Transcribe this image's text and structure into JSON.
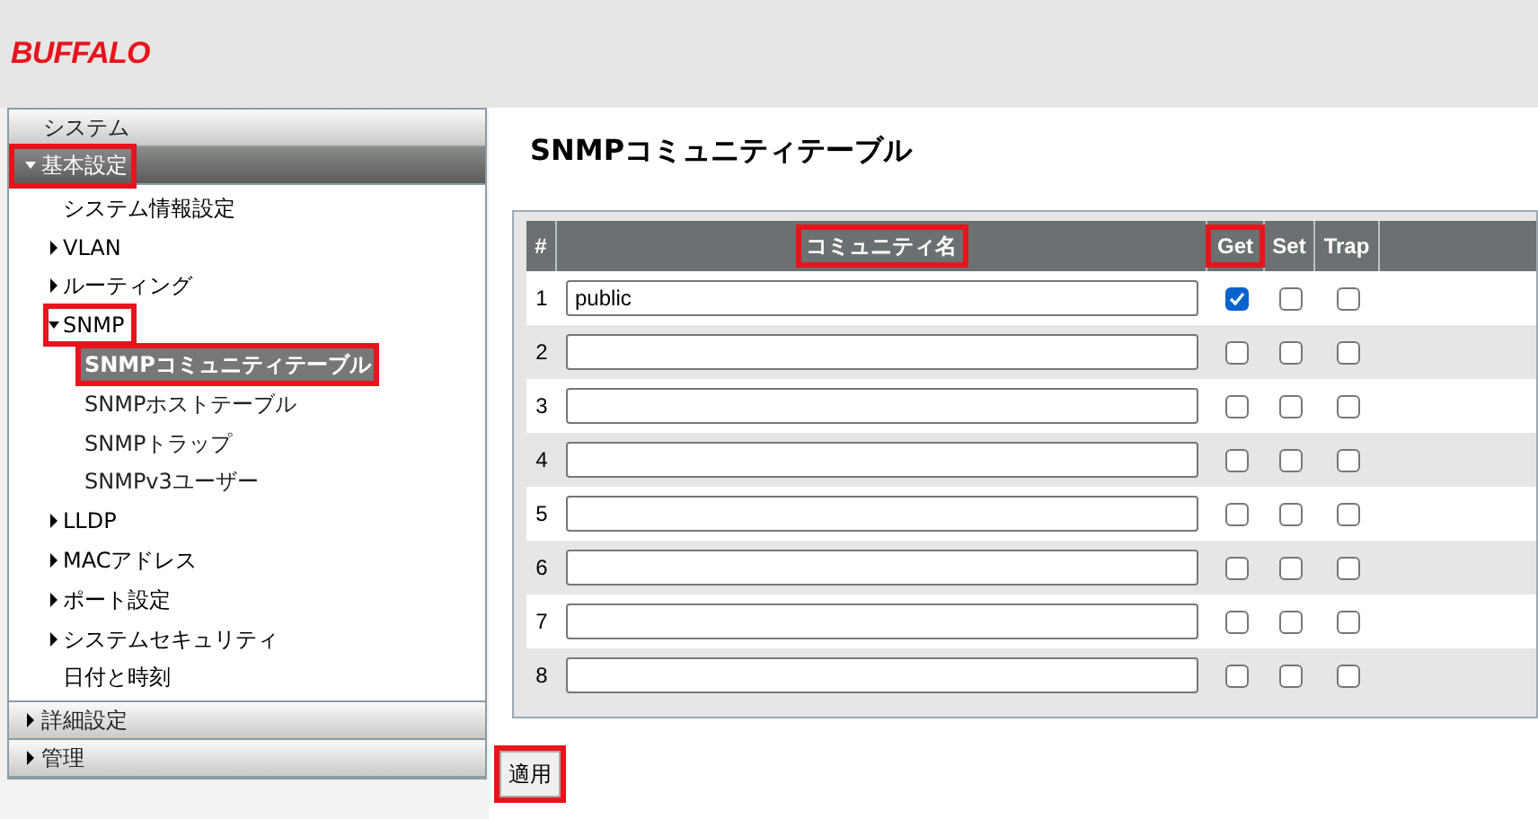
{
  "logo": "BUFFALO",
  "sidebar": {
    "sections": [
      {
        "label": "システム",
        "kind": "plain",
        "expanded": false,
        "highlighted": false
      },
      {
        "label": "基本設定",
        "kind": "toggle",
        "expanded": true,
        "highlighted": true,
        "items": [
          {
            "label": "システム情報設定",
            "kind": "leaf",
            "selected": false,
            "highlighted": false
          },
          {
            "label": "VLAN",
            "kind": "group",
            "expanded": false,
            "selected": false,
            "highlighted": false
          },
          {
            "label": "ルーティング",
            "kind": "group",
            "expanded": false,
            "selected": false,
            "highlighted": false
          },
          {
            "label": "SNMP",
            "kind": "group",
            "expanded": true,
            "selected": false,
            "highlighted": true,
            "children": [
              {
                "label": "SNMPコミュニティテーブル",
                "selected": true,
                "highlighted": true
              },
              {
                "label": "SNMPホストテーブル",
                "selected": false,
                "highlighted": false
              },
              {
                "label": "SNMPトラップ",
                "selected": false,
                "highlighted": false
              },
              {
                "label": "SNMPv3ユーザー",
                "selected": false,
                "highlighted": false
              }
            ]
          },
          {
            "label": "LLDP",
            "kind": "group",
            "expanded": false,
            "selected": false,
            "highlighted": false
          },
          {
            "label": "MACアドレス",
            "kind": "group",
            "expanded": false,
            "selected": false,
            "highlighted": false
          },
          {
            "label": "ポート設定",
            "kind": "group",
            "expanded": false,
            "selected": false,
            "highlighted": false
          },
          {
            "label": "システムセキュリティ",
            "kind": "group",
            "expanded": false,
            "selected": false,
            "highlighted": false
          },
          {
            "label": "日付と時刻",
            "kind": "leaf",
            "selected": false,
            "highlighted": false
          }
        ]
      },
      {
        "label": "詳細設定",
        "kind": "toggle",
        "expanded": false,
        "highlighted": false
      },
      {
        "label": "管理",
        "kind": "toggle",
        "expanded": false,
        "highlighted": false
      }
    ]
  },
  "page_title": "SNMPコミュニティテーブル",
  "table": {
    "columns": [
      {
        "label": "#",
        "highlighted": false
      },
      {
        "label": "コミュニティ名",
        "highlighted": true
      },
      {
        "label": "Get",
        "highlighted": true
      },
      {
        "label": "Set",
        "highlighted": false
      },
      {
        "label": "Trap",
        "highlighted": false
      }
    ],
    "rows": [
      {
        "index": "1",
        "value": "public",
        "get": true,
        "set": false,
        "trap": false
      },
      {
        "index": "2",
        "get": false,
        "set": false,
        "trap": false
      },
      {
        "index": "3",
        "get": false,
        "set": false,
        "trap": false
      },
      {
        "index": "4",
        "get": false,
        "set": false,
        "trap": false
      },
      {
        "index": "5",
        "get": false,
        "set": false,
        "trap": false
      },
      {
        "index": "6",
        "get": false,
        "set": false,
        "trap": false
      },
      {
        "index": "7",
        "get": false,
        "set": false,
        "trap": false
      },
      {
        "index": "8",
        "get": false,
        "set": false,
        "trap": false
      }
    ]
  },
  "apply_button": {
    "label": "適用",
    "highlighted": true
  }
}
